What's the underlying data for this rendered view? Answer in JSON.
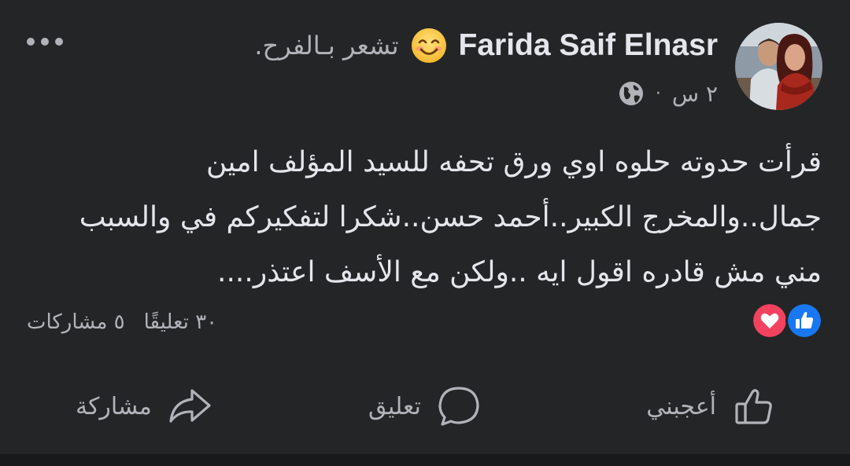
{
  "post": {
    "author": "Farida Saif Elnasr",
    "feeling": "تشعر بـالفرح.",
    "feeling_icon": "smiling-face-emoji",
    "time": "٢ س",
    "separator": "·",
    "audience_icon": "globe-icon",
    "text": "قرأت حدوته حلوه اوي ورق تحفه للسيد المؤلف  امين جمال..والمخرج الكبير..أحمد حسن..شكرا لتفكيركم في والسبب مني مش قادره اقول ايه ..ولكن مع الأسف اعتذر...."
  },
  "reactions": {
    "icons": [
      "like-reaction-icon",
      "love-reaction-icon"
    ],
    "like_color": "#1877f2",
    "love_color": "#f3425f",
    "comments_count": "٣٠ تعليقًا",
    "shares_count": "٥ مشاركات"
  },
  "actions": {
    "like_label": "أعجبني",
    "comment_label": "تعليق",
    "share_label": "مشاركة"
  }
}
